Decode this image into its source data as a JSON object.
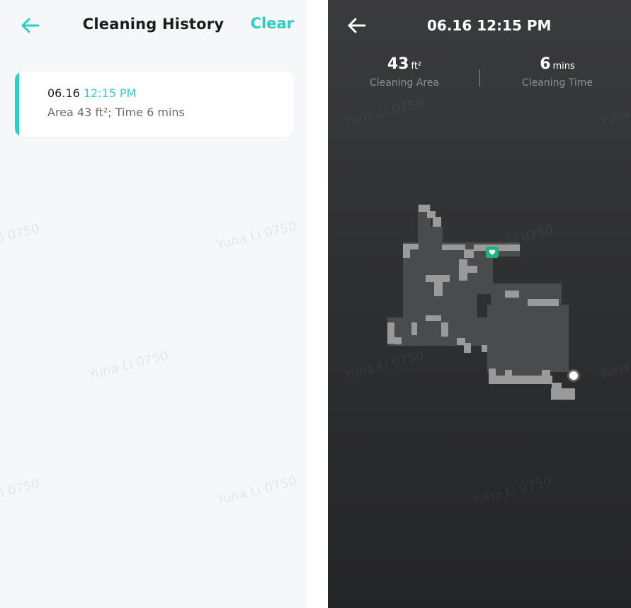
{
  "history": {
    "title": "Cleaning History",
    "clear_label": "Clear",
    "records": [
      {
        "date": "06.16",
        "time": "12:15 PM",
        "summary": "Area 43 ft²; Time 6 mins"
      }
    ]
  },
  "detail": {
    "title": "06.16 12:15 PM",
    "area_value": "43",
    "area_unit": "ft²",
    "area_label": "Cleaning Area",
    "time_value": "6",
    "time_unit": "mins",
    "time_label": "Cleaning Time"
  },
  "watermark": "Yuna Li 0750",
  "watermark_partial": "Li 0750",
  "watermark_short": "Yuna",
  "colors": {
    "accent": "#2ccfc3",
    "dark_bg": "#2f3032",
    "map_floor": "#4a4b4d",
    "map_wall": "#9a9a9a",
    "dock": "#1fb37a"
  }
}
